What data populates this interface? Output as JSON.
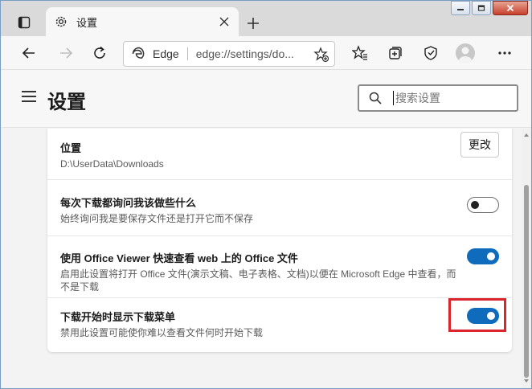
{
  "tab": {
    "title": "设置"
  },
  "address": {
    "site_label": "Edge",
    "url": "edge://settings/do..."
  },
  "settings": {
    "title": "设置",
    "search_placeholder": "搜索设置"
  },
  "downloads": {
    "location": {
      "title": "位置",
      "path": "D:\\UserData\\Downloads",
      "change_label": "更改"
    },
    "ask": {
      "title": "每次下载都询问我该做些什么",
      "desc": "始终询问我是要保存文件还是打开它而不保存",
      "enabled": false
    },
    "office_viewer": {
      "title": "使用 Office Viewer 快速查看 web 上的 Office 文件",
      "desc": "启用此设置将打开 Office 文件(演示文稿、电子表格、文档)以便在 Microsoft Edge 中查看，而不是下载",
      "enabled": true
    },
    "show_menu": {
      "title": "下载开始时显示下载菜单",
      "desc": "禁用此设置可能使你难以查看文件何时开始下载",
      "enabled": true
    }
  },
  "colors": {
    "accent": "#0f6cbd",
    "highlight": "#d9252b"
  }
}
